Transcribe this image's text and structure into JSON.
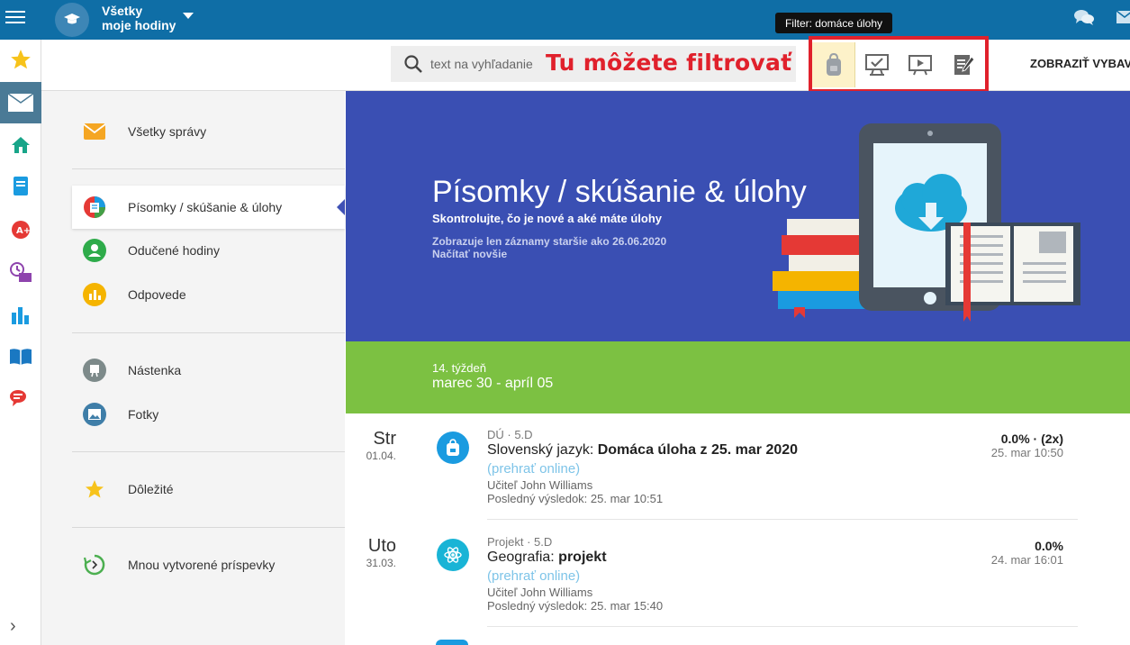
{
  "topbar": {
    "title_line1": "Všetky",
    "title_line2": "moje hodiny",
    "brand_color": "#0f6ea6"
  },
  "toolbar": {
    "search_placeholder": "text na vyhľadanie",
    "annotation": "Tu môžete filtrovať",
    "tooltip": "Filter: domáce úlohy",
    "show_button": "ZOBRAZIŤ VYBAV",
    "filters": [
      {
        "icon": "backpack-icon",
        "active": true
      },
      {
        "icon": "monitor-check-icon",
        "active": false
      },
      {
        "icon": "presentation-play-icon",
        "active": false
      },
      {
        "icon": "notebook-pen-icon",
        "active": false
      }
    ]
  },
  "rail": {
    "items": [
      {
        "icon": "star-icon"
      },
      {
        "icon": "mail-icon",
        "active": true
      },
      {
        "icon": "home-icon"
      },
      {
        "icon": "notebook-icon"
      },
      {
        "icon": "grade-icon"
      },
      {
        "icon": "schedule-icon"
      },
      {
        "icon": "bar-chart-icon"
      },
      {
        "icon": "book-open-icon"
      },
      {
        "icon": "chat-icon"
      }
    ]
  },
  "nav": {
    "items": [
      {
        "label": "Všetky správy",
        "icon": "mail-icon"
      },
      {
        "label": "Písomky / skúšanie & úlohy",
        "icon": "homework-icon",
        "active": true
      },
      {
        "label": "Odučené hodiny",
        "icon": "teacher-icon"
      },
      {
        "label": "Odpovede",
        "icon": "answers-icon"
      },
      {
        "label": "Nástenka",
        "icon": "board-icon"
      },
      {
        "label": "Fotky",
        "icon": "photo-icon"
      },
      {
        "label": "Dôležité",
        "icon": "star-icon"
      },
      {
        "label": "Mnou vytvorené príspevky",
        "icon": "refresh-icon"
      }
    ]
  },
  "banner": {
    "title": "Písomky / skúšanie & úlohy",
    "subtitle": "Skontrolujte, čo je nové a aké máte úlohy",
    "note": "Zobrazuje len záznamy staršie ako 26.06.2020",
    "load_newer": "Načítať novšie"
  },
  "week": {
    "label": "14. týždeň",
    "range": "marec 30 - apríl 05"
  },
  "entries": [
    {
      "day": "Str",
      "date": "01.04.",
      "type": "DÚ · 5.D",
      "subject": "Slovenský jazyk:",
      "title": "Domáca úloha z 25. mar 2020",
      "play": "(prehrať online)",
      "teacher": "Učiteľ John Williams",
      "last_result": "Posledný výsledok: 25. mar 10:51",
      "score": "0.0% · (2x)",
      "time": "25. mar 10:50",
      "icon": "backpack-icon",
      "color": "#1a9be0"
    },
    {
      "day": "Uto",
      "date": "31.03.",
      "type": "Projekt · 5.D",
      "subject": "Geografia:",
      "title": "projekt",
      "play": "(prehrať online)",
      "teacher": "Učiteľ John Williams",
      "last_result": "Posledný výsledok: 25. mar 15:40",
      "score": "0.0%",
      "time": "24. mar 16:01",
      "icon": "atom-icon",
      "color": "#19b4d6"
    }
  ]
}
